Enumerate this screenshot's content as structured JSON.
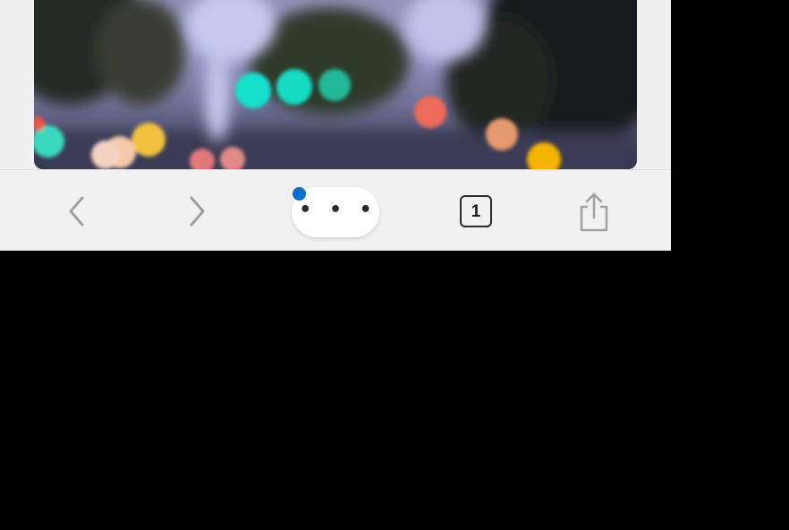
{
  "page": {
    "photo_description_icon": "blurred-street-lights-photo"
  },
  "toolbar": {
    "back_icon": "chevron-left-icon",
    "forward_icon": "chevron-right-icon",
    "more_label": "• • •",
    "tab_count": "1",
    "share_icon": "share-icon",
    "notification_color": "#0b6fd1"
  }
}
